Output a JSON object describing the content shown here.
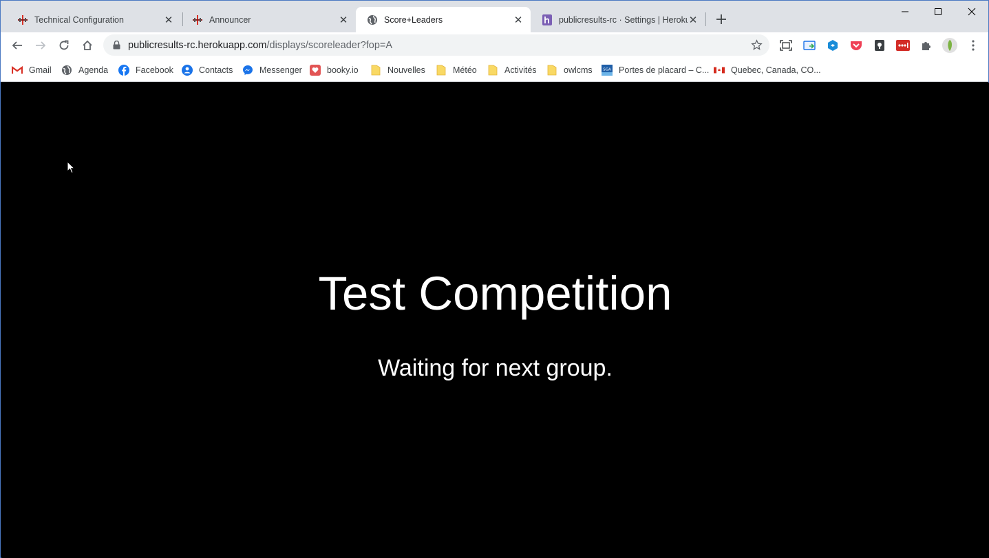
{
  "browser": {
    "tabs": [
      {
        "title": "Technical Configuration",
        "icon": "owlcms-icon",
        "active": false
      },
      {
        "title": "Announcer",
        "icon": "owlcms-icon",
        "active": false
      },
      {
        "title": "Score+Leaders",
        "icon": "globe-icon",
        "active": true
      },
      {
        "title": "publicresults-rc · Settings | Heroku",
        "icon": "heroku-icon",
        "active": false
      }
    ],
    "url": {
      "host": "publicresults-rc.herokuapp.com",
      "path": "/displays/scoreleader?fop=A"
    },
    "bookmarks": [
      {
        "label": "Gmail",
        "icon": "gmail-icon"
      },
      {
        "label": "Agenda",
        "icon": "globe-icon"
      },
      {
        "label": "Facebook",
        "icon": "facebook-icon"
      },
      {
        "label": "Contacts",
        "icon": "contacts-icon"
      },
      {
        "label": "Messenger",
        "icon": "messenger-icon"
      },
      {
        "label": "booky.io",
        "icon": "booky-icon"
      },
      {
        "label": "Nouvelles",
        "icon": "folder-icon"
      },
      {
        "label": "Météo",
        "icon": "folder-icon"
      },
      {
        "label": "Activités",
        "icon": "folder-icon"
      },
      {
        "label": "owlcms",
        "icon": "folder-icon"
      },
      {
        "label": "Portes de placard – C...",
        "icon": "sga-icon"
      },
      {
        "label": "Quebec, Canada, CO...",
        "icon": "canada-flag-icon"
      }
    ],
    "extensions": [
      "screenshot-icon",
      "cast-icon",
      "cube-extension-icon",
      "pocket-icon",
      "keep-icon",
      "lastpass-icon",
      "puzzle-icon"
    ],
    "colors": {
      "tabstrip": "#dee1e6",
      "accent": "#1a73e8"
    }
  },
  "page": {
    "competition_title": "Test Competition",
    "status_message": "Waiting for next group."
  }
}
